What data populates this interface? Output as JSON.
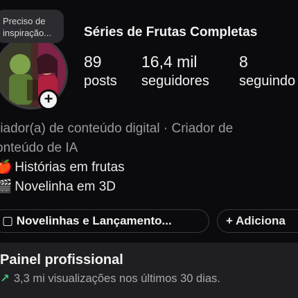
{
  "note": {
    "text_line1": "Preciso de",
    "text_line2": "inspiração..."
  },
  "profile": {
    "name": "Séries de Frutas Completas"
  },
  "stats": {
    "posts": {
      "value": "89",
      "label": "posts"
    },
    "followers": {
      "value": "16,4 mil",
      "label": "seguidores"
    },
    "following": {
      "value": "8",
      "label": "seguindo"
    }
  },
  "bio": {
    "category_line1": "riador(a) de conteúdo digital · Criador de",
    "category_line2": "onteúdo de IA",
    "line1_emoji": "🍎",
    "line1_text": "Histórias em frutas",
    "line2_emoji": "🎬",
    "line2_text": "Novelinha em 3D"
  },
  "chips": {
    "playlist_icon": "▢",
    "playlist_label": "Novelinhas e Lançamento...",
    "add_label": "+ Adiciona"
  },
  "dashboard": {
    "title": "Painel profissional",
    "trend_icon": "↗",
    "subtitle": "3,3 mi visualizações nos últimos 30 dias."
  },
  "colors": {
    "background": "#0b0b0d",
    "panel": "#1f1f22",
    "trend": "#3cc47a"
  },
  "icons": {
    "plus": "plus-icon",
    "trend": "trend-up-icon",
    "playlist": "playlist-icon"
  }
}
